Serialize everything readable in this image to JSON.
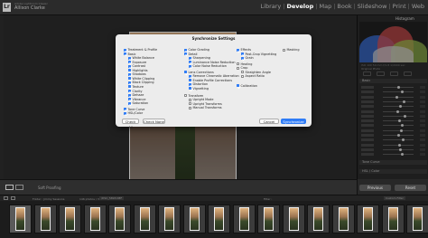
{
  "app": {
    "logo": "Lr",
    "catalog": "Adobe Lightroom Classic",
    "user": "Allison Clarke"
  },
  "modules": [
    "Library",
    "Develop",
    "Map",
    "Book",
    "Slideshow",
    "Print",
    "Web"
  ],
  "active_module": "Develop",
  "right_panel": {
    "histogram_title": "Histogram",
    "histogram_info": "ISO 100   50 mm   f/1.8   1/2000 sec",
    "original_photo": "Original Photo",
    "sections": [
      "Basic",
      "Tone Curve",
      "HSL / Color"
    ],
    "previous_button": "Previous",
    "reset_button": "Reset"
  },
  "toolbar": {
    "soft_proofing": "Soft Proofing"
  },
  "filmstrip_header": {
    "folder": "Folder : Jimmy Sessions",
    "count": "146 photos / 30 selected",
    "file": "/DSC_5893.NEF",
    "filter": "Filter :",
    "filter_value": "Custom Filter"
  },
  "dialog": {
    "title": "Synchronize Settings",
    "col1": [
      {
        "label": "Treatment & Profile",
        "checked": true
      },
      {
        "label": "Basic",
        "checked": true
      },
      {
        "label": "White Balance",
        "checked": true,
        "indent": true
      },
      {
        "label": "Exposure",
        "checked": true,
        "indent": true
      },
      {
        "label": "Contrast",
        "checked": true,
        "indent": true
      },
      {
        "label": "Highlights",
        "checked": true,
        "indent": true
      },
      {
        "label": "Shadows",
        "checked": true,
        "indent": true
      },
      {
        "label": "White Clipping",
        "checked": true,
        "indent": true
      },
      {
        "label": "Black Clipping",
        "checked": true,
        "indent": true
      },
      {
        "label": "Texture",
        "checked": true,
        "indent": true
      },
      {
        "label": "Clarity",
        "checked": true,
        "indent": true
      },
      {
        "label": "Dehaze",
        "checked": true,
        "indent": true
      },
      {
        "label": "Vibrance",
        "checked": true,
        "indent": true
      },
      {
        "label": "Saturation",
        "checked": true,
        "indent": true
      },
      {
        "label": "Tone Curve",
        "checked": true
      },
      {
        "label": "HSL/Color",
        "checked": true
      }
    ],
    "col2": [
      {
        "label": "Color Grading",
        "checked": true
      },
      {
        "label": "Detail",
        "checked": true
      },
      {
        "label": "Sharpening",
        "checked": true,
        "indent": true
      },
      {
        "label": "Luminance Noise Reduction",
        "checked": true,
        "indent": true
      },
      {
        "label": "Color Noise Reduction",
        "checked": true,
        "indent": true
      },
      {
        "label": "Lens Corrections",
        "checked": true
      },
      {
        "label": "Remove Chromatic Aberration",
        "checked": true,
        "indent": true
      },
      {
        "label": "Enable Profile Corrections",
        "checked": true,
        "indent": true
      },
      {
        "label": "Distortion",
        "checked": true,
        "indent": true
      },
      {
        "label": "Vignetting",
        "checked": true,
        "indent": true
      },
      {
        "label": "Transform",
        "checked": false
      },
      {
        "label": "Upright Mode",
        "checked": false,
        "indent": true
      },
      {
        "label": "Upright Transforms",
        "checked": false,
        "indent": true
      },
      {
        "label": "Manual Transforms",
        "checked": false,
        "indent": true
      }
    ],
    "col3": [
      {
        "label": "Effects",
        "checked": true
      },
      {
        "label": "Post-Crop Vignetting",
        "checked": true,
        "indent": true
      },
      {
        "label": "Grain",
        "checked": true,
        "indent": true
      },
      {
        "label": "Healing",
        "checked": false
      },
      {
        "label": "Crop",
        "checked": false
      },
      {
        "label": "Straighten Angle",
        "checked": false,
        "indent": true
      },
      {
        "label": "Aspect Ratio",
        "checked": false,
        "indent": true
      },
      {
        "label": "Calibration",
        "checked": true
      }
    ],
    "col4": [
      {
        "label": "Masking",
        "checked": false
      }
    ],
    "check_all": "Check All",
    "check_none": "Check None",
    "cancel": "Cancel",
    "synchronize": "Synchronize"
  },
  "colors": {
    "accent": "#2f7cf6",
    "dialog_bg": "#ececec"
  }
}
